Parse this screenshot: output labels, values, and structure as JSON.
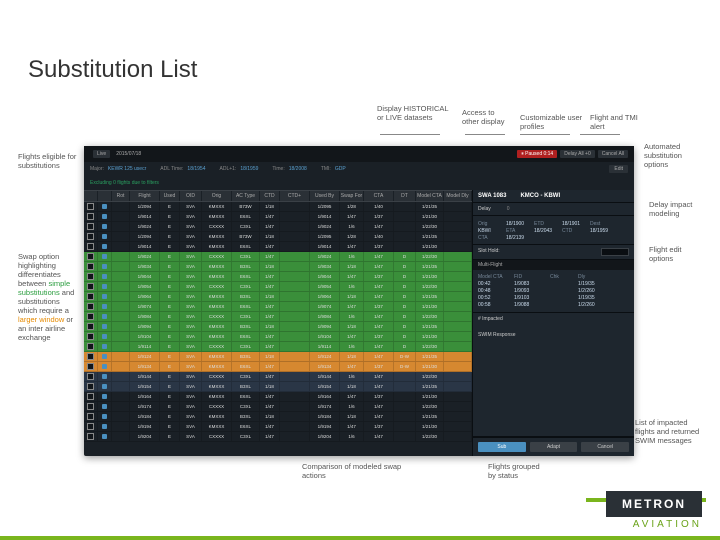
{
  "title": "Substitution List",
  "callouts": {
    "display": "Display HISTORICAL or LIVE datasets",
    "access": "Access to other display",
    "custom": "Customizable user profiles",
    "tmi": "Flight and TMI alert",
    "auto": "Automated substitution options",
    "delay": "Delay impact modeling",
    "edit": "Flight edit options",
    "eligible": "Flights eligible for substitutions",
    "swap_pre": "Swap option highlighting differentiates between ",
    "swap_simple": "simple substitutions",
    "swap_mid": " and substitutions which require a ",
    "swap_larger": "larger window",
    "swap_post": " or an inter airline exchange",
    "compare": "Comparison of modeled swap actions",
    "grouped": "Flights grouped by status",
    "impacted": "List of impacted flights and returned SWIM messages"
  },
  "toolbar": {
    "live_label": "Live",
    "date": "2015/07/18",
    "pause": "⏸ Paused 0:14",
    "delay": "Delay All +0",
    "cancel": "Cancel All"
  },
  "filters": {
    "major_lbl": "Major:",
    "major": "KEWR 125 usecr",
    "adl_lbl": "ADL Time:",
    "adl": "18/1954",
    "adl2_lbl": "ADL+1:",
    "adl2": "18/1959",
    "time_lbl": "Time:",
    "time": "18/2008",
    "tmi_lbl": "TMI:",
    "tmi": "GDP",
    "edit_btn": "Edit"
  },
  "subhead": "Excluding 0 flights due to filters",
  "columns": [
    "",
    "",
    "Rot",
    "Flight",
    "Used",
    "OID",
    "Orig",
    "AC Type",
    "CTD",
    "CTD+",
    "Used By",
    "Swap For",
    "CTA",
    "DT",
    "Model CTA",
    "Model Dly"
  ],
  "rows": [
    {
      "c": "dark",
      "d": [
        "",
        "",
        "",
        "1/2094",
        "E",
        "SVA",
        "KMXXX",
        "B73W",
        "1/18",
        "",
        "1/2095",
        "1/28",
        "1/40",
        "",
        "1/21/35",
        ""
      ]
    },
    {
      "c": "dark",
      "d": [
        "",
        "",
        "",
        "1/9014",
        "E",
        "SVA",
        "KMXXX",
        "E6XL",
        "1/47",
        "",
        "1/9014",
        "1/47",
        "1/37",
        "",
        "1/21/30",
        ""
      ]
    },
    {
      "c": "dark",
      "d": [
        "",
        "",
        "",
        "1/9024",
        "E",
        "SVA",
        "CXXXX",
        "C3XL",
        "1/47",
        "",
        "1/9024",
        "1/6",
        "1/47",
        "",
        "1/22/30",
        ""
      ]
    },
    {
      "c": "dark",
      "d": [
        "",
        "",
        "",
        "1/2094",
        "E",
        "SVA",
        "KMXXX",
        "B73W",
        "1/18",
        "",
        "1/2095",
        "1/28",
        "1/40",
        "",
        "1/21/35",
        ""
      ]
    },
    {
      "c": "dark",
      "d": [
        "",
        "",
        "",
        "1/9014",
        "E",
        "SVA",
        "KMXXX",
        "E6XL",
        "1/47",
        "",
        "1/9014",
        "1/47",
        "1/37",
        "",
        "1/21/30",
        ""
      ]
    },
    {
      "c": "green",
      "d": [
        "",
        "",
        "",
        "1/9024",
        "E",
        "SVA",
        "CXXXX",
        "C3XL",
        "1/47",
        "",
        "1/9024",
        "1/6",
        "1/47",
        "D",
        "1/22/30",
        ""
      ]
    },
    {
      "c": "green",
      "d": [
        "",
        "",
        "",
        "1/9034",
        "E",
        "SVA",
        "KMXXX",
        "B3XL",
        "1/18",
        "",
        "1/9034",
        "1/18",
        "1/47",
        "D",
        "1/21/35",
        ""
      ]
    },
    {
      "c": "green",
      "d": [
        "",
        "",
        "",
        "1/9044",
        "E",
        "SVA",
        "KMXXX",
        "E6XL",
        "1/47",
        "",
        "1/9044",
        "1/47",
        "1/37",
        "D",
        "1/21/30",
        ""
      ]
    },
    {
      "c": "green",
      "d": [
        "",
        "",
        "",
        "1/9054",
        "E",
        "SVA",
        "CXXXX",
        "C3XL",
        "1/47",
        "",
        "1/9054",
        "1/6",
        "1/47",
        "D",
        "1/22/30",
        ""
      ]
    },
    {
      "c": "green",
      "d": [
        "",
        "",
        "",
        "1/9064",
        "E",
        "SVA",
        "KMXXX",
        "B3XL",
        "1/18",
        "",
        "1/9064",
        "1/18",
        "1/47",
        "D",
        "1/21/35",
        ""
      ]
    },
    {
      "c": "green",
      "d": [
        "",
        "",
        "",
        "1/9074",
        "E",
        "SVA",
        "KMXXX",
        "E6XL",
        "1/47",
        "",
        "1/9074",
        "1/47",
        "1/37",
        "D",
        "1/21/30",
        ""
      ]
    },
    {
      "c": "green",
      "d": [
        "",
        "",
        "",
        "1/9084",
        "E",
        "SVA",
        "CXXXX",
        "C3XL",
        "1/47",
        "",
        "1/9084",
        "1/6",
        "1/47",
        "D",
        "1/22/30",
        ""
      ]
    },
    {
      "c": "green",
      "d": [
        "",
        "",
        "",
        "1/9094",
        "E",
        "SVA",
        "KMXXX",
        "B3XL",
        "1/18",
        "",
        "1/9094",
        "1/18",
        "1/47",
        "D",
        "1/21/35",
        ""
      ]
    },
    {
      "c": "green",
      "d": [
        "",
        "",
        "",
        "1/9104",
        "E",
        "SVA",
        "KMXXX",
        "E6XL",
        "1/47",
        "",
        "1/9104",
        "1/47",
        "1/37",
        "D",
        "1/21/30",
        ""
      ]
    },
    {
      "c": "green",
      "d": [
        "",
        "",
        "",
        "1/9114",
        "E",
        "SVA",
        "CXXXX",
        "C3XL",
        "1/47",
        "",
        "1/9114",
        "1/6",
        "1/47",
        "D",
        "1/22/30",
        ""
      ]
    },
    {
      "c": "orange",
      "d": [
        "",
        "",
        "",
        "1/9124",
        "E",
        "SVA",
        "KMXXX",
        "B3XL",
        "1/18",
        "",
        "1/9124",
        "1/18",
        "1/47",
        "D-W",
        "1/21/35",
        ""
      ]
    },
    {
      "c": "orange",
      "d": [
        "",
        "",
        "",
        "1/9134",
        "E",
        "SVA",
        "KMXXX",
        "E6XL",
        "1/47",
        "",
        "1/9134",
        "1/47",
        "1/37",
        "D-W",
        "1/21/30",
        ""
      ]
    },
    {
      "c": "dblue",
      "d": [
        "",
        "",
        "",
        "1/9144",
        "E",
        "SVA",
        "CXXXX",
        "C3XL",
        "1/47",
        "",
        "1/9144",
        "1/6",
        "1/47",
        "",
        "1/22/30",
        ""
      ]
    },
    {
      "c": "dblue",
      "d": [
        "",
        "",
        "",
        "1/9154",
        "E",
        "SVA",
        "KMXXX",
        "B3XL",
        "1/18",
        "",
        "1/9154",
        "1/18",
        "1/47",
        "",
        "1/21/35",
        ""
      ]
    },
    {
      "c": "dark",
      "d": [
        "",
        "",
        "",
        "1/9164",
        "E",
        "SVA",
        "KMXXX",
        "E6XL",
        "1/47",
        "",
        "1/9164",
        "1/47",
        "1/37",
        "",
        "1/21/30",
        ""
      ]
    },
    {
      "c": "dark",
      "d": [
        "",
        "",
        "",
        "1/9174",
        "E",
        "SVA",
        "CXXXX",
        "C3XL",
        "1/47",
        "",
        "1/9174",
        "1/6",
        "1/47",
        "",
        "1/22/30",
        ""
      ]
    },
    {
      "c": "dark",
      "d": [
        "",
        "",
        "",
        "1/9184",
        "E",
        "SVA",
        "KMXXX",
        "B3XL",
        "1/18",
        "",
        "1/9184",
        "1/18",
        "1/47",
        "",
        "1/21/35",
        ""
      ]
    },
    {
      "c": "dark",
      "d": [
        "",
        "",
        "",
        "1/9194",
        "E",
        "SVA",
        "KMXXX",
        "E6XL",
        "1/47",
        "",
        "1/9194",
        "1/47",
        "1/37",
        "",
        "1/21/30",
        ""
      ]
    },
    {
      "c": "dark",
      "d": [
        "",
        "",
        "",
        "1/9204",
        "E",
        "SVA",
        "CXXXX",
        "C3XL",
        "1/47",
        "",
        "1/9204",
        "1/6",
        "1/47",
        "",
        "1/22/30",
        ""
      ]
    }
  ],
  "side": {
    "flight": "SWA 1083",
    "route": "KMCO - KBWI",
    "delay_lbl": "Delay",
    "delay_val": "0",
    "pairs": [
      [
        "Orig",
        "18/1900",
        "ETD",
        "18/1901"
      ],
      [
        "Dest",
        "KBWI",
        "ETA",
        "18/2043"
      ],
      [
        "CTD",
        "18/1959",
        "CTA",
        "18/2139"
      ]
    ],
    "edit_lbl": "Slot Hold:",
    "multi_head": "Multi-Flight",
    "grid_h": [
      "Model CTA",
      "FID",
      "Chk",
      "Dly"
    ],
    "grid_rows": [
      [
        "00:42",
        "1/9083",
        "",
        "1/19/35"
      ],
      [
        "00:48",
        "1/9093",
        "",
        "1/2/260"
      ],
      [
        "00:52",
        "1/9103",
        "",
        "1/19/35"
      ],
      [
        "00:58",
        "1/9088",
        "",
        "1/2/260"
      ]
    ],
    "impacted": "# Impacted",
    "swim": "SWIM Response",
    "btn_sub": "Sub",
    "btn_adapt": "Adapt",
    "btn_cancel": "Cancel"
  },
  "logo": {
    "name": "METRON",
    "sub": "AVIATION"
  }
}
